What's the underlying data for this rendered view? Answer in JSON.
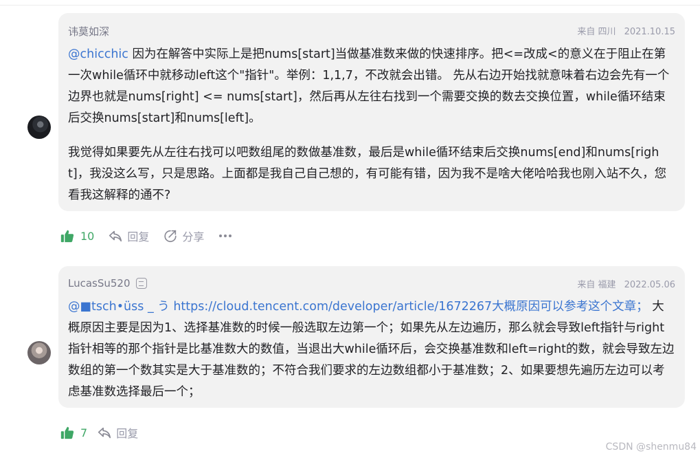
{
  "comments": [
    {
      "author": "讳莫如深",
      "location": "来自 四川",
      "date": "2021.10.15",
      "mention": "@chicchic",
      "paragraph1": " 因为在解答中实际上是把nums[start]当做基准数来做的快速排序。把<=改成<的意义在于阻止在第一次while循环中就移动left这个\"指针\"。举例：1,1,7，不改就会出错。 先从右边开始找就意味着右边会先有一个边界也就是nums[right] <= nums[start]，然后再从左往右找到一个需要交换的数去交换位置，while循环结束后交换nums[start]和nums[left]。",
      "paragraph2": "我觉得如果要先从左往右找可以吧数组尾的数做基准数，最后是while循环结束后交换nums[end]和nums[right]，我没这么写，只是思路。上面都是我自己自己想的，有可能有错，因为我不是啥大佬哈哈我也刚入站不久，您看我这解释的通不?",
      "likes": "10",
      "reply_label": "回复",
      "share_label": "分享"
    },
    {
      "author": "LucasSu520",
      "location": "来自 福建",
      "date": "2022.05.06",
      "mention": "@■tsch•üss _ う",
      "link": " https://cloud.tencent.com/developer/article/1672267大概原因可以参考这个文章；",
      "paragraph1": " 大概原因主要是因为1、选择基准数的时候一般选取左边第一个；如果先从左边遍历，那么就会导致left指针与right指针相等的那个指针是比基准数大的数值，当退出大while循环后，会交换基准数和left=right的数，就会导致左边数组的第一个数其实是大于基准数的；不符合我们要求的左边数组都小于基准数；2、如果要想先遍历左边可以考虑基准数选择最后一个；",
      "likes": "7",
      "reply_label": "回复"
    }
  ],
  "watermark": "CSDN @shenmu84",
  "colors": {
    "accent_green": "#3fa766",
    "link_blue": "#3b75d0",
    "bubble_bg": "#f2f2f2"
  }
}
